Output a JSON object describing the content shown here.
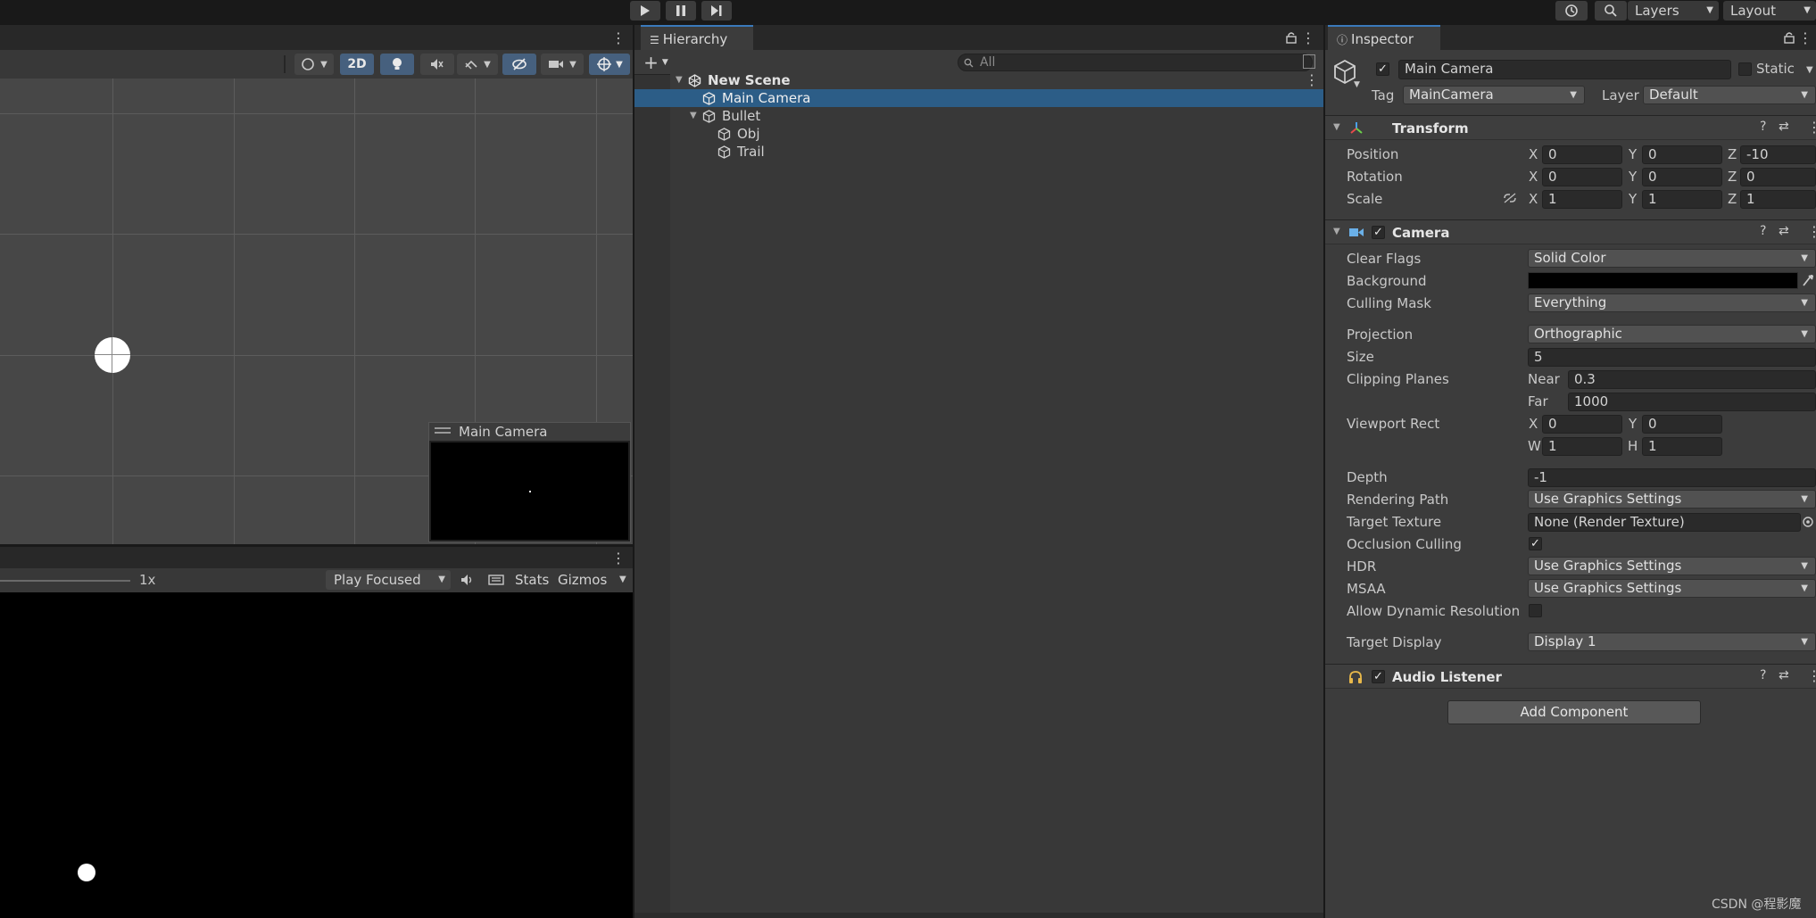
{
  "toolbar": {
    "layers_label": "Layers",
    "layout_label": "Layout"
  },
  "scene": {
    "btn_2d": "2D",
    "preview_title": "Main Camera"
  },
  "game": {
    "scale_label": "1x",
    "play_mode": "Play Focused",
    "stats_label": "Stats",
    "gizmos_label": "Gizmos"
  },
  "hierarchy": {
    "tab": "Hierarchy",
    "search_placeholder": "All",
    "items": [
      {
        "label": "New Scene"
      },
      {
        "label": "Main Camera"
      },
      {
        "label": "Bullet"
      },
      {
        "label": "Obj"
      },
      {
        "label": "Trail"
      }
    ]
  },
  "inspector": {
    "tab": "Inspector",
    "object_name": "Main Camera",
    "static_label": "Static",
    "tag_label": "Tag",
    "tag_value": "MainCamera",
    "layer_label": "Layer",
    "layer_value": "Default",
    "transform": {
      "title": "Transform",
      "position_label": "Position",
      "rotation_label": "Rotation",
      "scale_label": "Scale",
      "position": {
        "x": "0",
        "y": "0",
        "z": "-10"
      },
      "rotation": {
        "x": "0",
        "y": "0",
        "z": "0"
      },
      "scale": {
        "x": "1",
        "y": "1",
        "z": "1"
      }
    },
    "camera": {
      "title": "Camera",
      "clear_flags_label": "Clear Flags",
      "clear_flags": "Solid Color",
      "background_label": "Background",
      "background_color": "#000000",
      "culling_mask_label": "Culling Mask",
      "culling_mask": "Everything",
      "projection_label": "Projection",
      "projection": "Orthographic",
      "size_label": "Size",
      "size": "5",
      "clipping_label": "Clipping Planes",
      "near_label": "Near",
      "near": "0.3",
      "far_label": "Far",
      "far": "1000",
      "viewport_label": "Viewport Rect",
      "vp_x": "0",
      "vp_y": "0",
      "vp_w": "1",
      "vp_h": "1",
      "depth_label": "Depth",
      "depth": "-1",
      "rendering_path_label": "Rendering Path",
      "rendering_path": "Use Graphics Settings",
      "target_texture_label": "Target Texture",
      "target_texture": "None (Render Texture)",
      "occlusion_label": "Occlusion Culling",
      "hdr_label": "HDR",
      "hdr": "Use Graphics Settings",
      "msaa_label": "MSAA",
      "msaa": "Use Graphics Settings",
      "dynres_label": "Allow Dynamic Resolution",
      "target_display_label": "Target Display",
      "target_display": "Display 1"
    },
    "audio_listener": {
      "title": "Audio Listener"
    },
    "add_component": "Add Component"
  },
  "watermark": "CSDN @程影魔",
  "colors": {
    "selection": "#2c5d87",
    "accent": "#3a79bb"
  }
}
